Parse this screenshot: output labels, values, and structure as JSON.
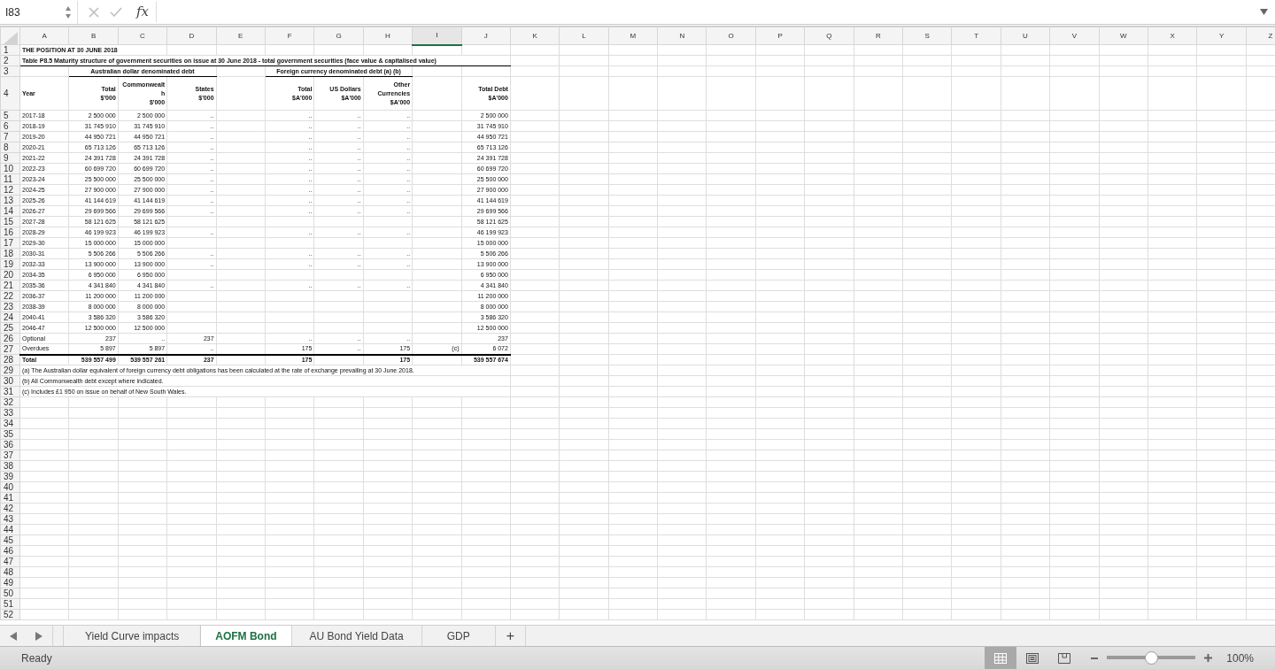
{
  "formula_bar": {
    "name_box": "I83",
    "fx": "fx"
  },
  "columns": [
    {
      "letter": "A",
      "selected": false
    },
    {
      "letter": "B",
      "selected": false
    },
    {
      "letter": "C",
      "selected": false
    },
    {
      "letter": "D",
      "selected": false
    },
    {
      "letter": "E",
      "selected": false
    },
    {
      "letter": "F",
      "selected": false
    },
    {
      "letter": "G",
      "selected": false
    },
    {
      "letter": "H",
      "selected": false
    },
    {
      "letter": "I",
      "selected": true
    },
    {
      "letter": "J",
      "selected": false
    },
    {
      "letter": "K",
      "selected": false
    },
    {
      "letter": "L",
      "selected": false
    },
    {
      "letter": "M",
      "selected": false
    },
    {
      "letter": "N",
      "selected": false
    },
    {
      "letter": "O",
      "selected": false
    },
    {
      "letter": "P",
      "selected": false
    },
    {
      "letter": "Q",
      "selected": false
    },
    {
      "letter": "R",
      "selected": false
    },
    {
      "letter": "S",
      "selected": false
    },
    {
      "letter": "T",
      "selected": false
    },
    {
      "letter": "U",
      "selected": false
    },
    {
      "letter": "V",
      "selected": false
    },
    {
      "letter": "W",
      "selected": false
    },
    {
      "letter": "X",
      "selected": false
    },
    {
      "letter": "Y",
      "selected": false
    },
    {
      "letter": "Z",
      "selected": false
    }
  ],
  "rows": [
    {
      "number": "1",
      "kind": "title",
      "cells": {
        "A": "THE POSITION AT 30 JUNE 2018"
      }
    },
    {
      "number": "2",
      "kind": "subtitle",
      "cells": {
        "A": "Table P8.5 Maturity structure of government securities on issue at 30 June 2018 - total government securities (face value & capitalised value)"
      }
    },
    {
      "number": "3",
      "kind": "group",
      "cells": {
        "B": "Australian dollar denominated debt",
        "F": "Foreign currency denominated debt (a) (b)"
      }
    },
    {
      "number": "4",
      "kind": "header",
      "cells": {
        "A": "Year",
        "B": "Total\n$'000",
        "C": "Commonwealt\nh\n$'000",
        "D": "States\n$'000",
        "F": "Total\n$A'000",
        "G": "US Dollars\n$A'000",
        "H": "Other\nCurrencies\n$A'000",
        "J": "Total Debt\n$A'000"
      }
    },
    {
      "number": "5",
      "kind": "data",
      "cells": {
        "A": "2017-18",
        "B": "2 500 000",
        "C": "2 500 000",
        "D": "..",
        "F": "..",
        "G": "..",
        "H": "..",
        "J": "2 500 000"
      }
    },
    {
      "number": "6",
      "kind": "data",
      "cells": {
        "A": "2018-19",
        "B": "31 745 910",
        "C": "31 745 910",
        "D": "..",
        "F": "..",
        "G": "..",
        "H": "..",
        "J": "31 745 910"
      }
    },
    {
      "number": "7",
      "kind": "data",
      "cells": {
        "A": "2019-20",
        "B": "44 950 721",
        "C": "44 950 721",
        "D": "..",
        "F": "..",
        "G": "..",
        "H": "..",
        "J": "44 950 721"
      }
    },
    {
      "number": "8",
      "kind": "data",
      "cells": {
        "A": "2020-21",
        "B": "65 713 126",
        "C": "65 713 126",
        "D": "..",
        "F": "..",
        "G": "..",
        "H": "..",
        "J": "65 713 126"
      }
    },
    {
      "number": "9",
      "kind": "data",
      "cells": {
        "A": "2021-22",
        "B": "24 391 728",
        "C": "24 391 728",
        "D": "..",
        "F": "..",
        "G": "..",
        "H": "..",
        "J": "24 391 728"
      }
    },
    {
      "number": "10",
      "kind": "data",
      "cells": {
        "A": "2022-23",
        "B": "60 699 720",
        "C": "60 699 720",
        "D": "..",
        "F": "..",
        "G": "..",
        "H": "..",
        "J": "60 699 720"
      }
    },
    {
      "number": "11",
      "kind": "data",
      "cells": {
        "A": "2023-24",
        "B": "25 500 000",
        "C": "25 500 000",
        "D": "..",
        "F": "..",
        "G": "..",
        "H": "..",
        "J": "25 500 000"
      }
    },
    {
      "number": "12",
      "kind": "data",
      "cells": {
        "A": "2024-25",
        "B": "27 900 000",
        "C": "27 900 000",
        "D": "..",
        "F": "..",
        "G": "..",
        "H": "..",
        "J": "27 900 000"
      }
    },
    {
      "number": "13",
      "kind": "data",
      "cells": {
        "A": "2025-26",
        "B": "41 144 619",
        "C": "41 144 619",
        "D": "..",
        "F": "..",
        "G": "..",
        "H": "..",
        "J": "41 144 619"
      }
    },
    {
      "number": "14",
      "kind": "data",
      "cells": {
        "A": "2026-27",
        "B": "29 699 566",
        "C": "29 699 566",
        "D": "..",
        "F": "..",
        "G": "..",
        "H": "..",
        "J": "29 699 566"
      }
    },
    {
      "number": "15",
      "kind": "data",
      "cells": {
        "A": "2027-28",
        "B": "58 121 625",
        "C": "58 121 625",
        "J": "58 121 625"
      }
    },
    {
      "number": "16",
      "kind": "data",
      "cells": {
        "A": "2028-29",
        "B": "46 199 923",
        "C": "46 199 923",
        "D": "..",
        "F": "..",
        "G": "..",
        "H": "..",
        "J": "46 199 923"
      }
    },
    {
      "number": "17",
      "kind": "data",
      "cells": {
        "A": "2029-30",
        "B": "15 000 000",
        "C": "15 000 000",
        "J": "15 000 000"
      }
    },
    {
      "number": "18",
      "kind": "data",
      "cells": {
        "A": "2030-31",
        "B": "5 506 266",
        "C": "5 506 266",
        "D": "..",
        "F": "..",
        "G": "..",
        "H": "..",
        "J": "5 506 266"
      }
    },
    {
      "number": "19",
      "kind": "data",
      "cells": {
        "A": "2032-33",
        "B": "13 900 000",
        "C": "13 900 000",
        "D": "..",
        "F": "..",
        "G": "..",
        "H": "..",
        "J": "13 900 000"
      }
    },
    {
      "number": "20",
      "kind": "data",
      "cells": {
        "A": "2034-35",
        "B": "6 950 000",
        "C": "6 950 000",
        "J": "6 950 000"
      }
    },
    {
      "number": "21",
      "kind": "data",
      "cells": {
        "A": "2035-36",
        "B": "4 341 840",
        "C": "4 341 840",
        "D": "..",
        "F": "..",
        "G": "..",
        "H": "..",
        "J": "4 341 840"
      }
    },
    {
      "number": "22",
      "kind": "data",
      "cells": {
        "A": "2036-37",
        "B": "11 200 000",
        "C": "11 200 000",
        "J": "11 200 000"
      }
    },
    {
      "number": "23",
      "kind": "data",
      "cells": {
        "A": "2038-39",
        "B": "8 000 000",
        "C": "8 000 000",
        "J": "8 000 000"
      }
    },
    {
      "number": "24",
      "kind": "data",
      "cells": {
        "A": "2040-41",
        "B": "3 586 320",
        "C": "3 586 320",
        "J": "3 586 320"
      }
    },
    {
      "number": "25",
      "kind": "data",
      "cells": {
        "A": "2046-47",
        "B": "12 500 000",
        "C": "12 500 000",
        "J": "12 500 000"
      }
    },
    {
      "number": "26",
      "kind": "data",
      "cells": {
        "A": "Optional",
        "B": "237",
        "C": "..",
        "D": "237",
        "F": "..",
        "G": "..",
        "H": "..",
        "J": "237"
      }
    },
    {
      "number": "27",
      "kind": "data",
      "cells": {
        "A": "Overdues",
        "B": "5 897",
        "C": "5 897",
        "D": "..",
        "F": "175",
        "G": "..",
        "H": "175",
        "I": "(c)",
        "J": "6 072"
      }
    },
    {
      "number": "28",
      "kind": "total",
      "cells": {
        "A": "Total",
        "B": "539 557 499",
        "C": "539 557 261",
        "D": "237",
        "F": "175",
        "H": "175",
        "J": "539 557 674"
      }
    },
    {
      "number": "29",
      "kind": "note",
      "cells": {
        "A": "(a) The Australian dollar equivalent of foreign currency debt obligations has been calculated at the rate of exchange prevailing at 30 June 2018."
      }
    },
    {
      "number": "30",
      "kind": "note",
      "cells": {
        "A": "(b) All Commonwealth debt except where indicated."
      }
    },
    {
      "number": "31",
      "kind": "note",
      "cells": {
        "A": "(c) Includes £1 950 on issue on behalf of New South Wales."
      }
    },
    {
      "number": "32",
      "kind": "data"
    },
    {
      "number": "33",
      "kind": "data"
    },
    {
      "number": "34",
      "kind": "data"
    },
    {
      "number": "35",
      "kind": "data"
    },
    {
      "number": "36",
      "kind": "data"
    },
    {
      "number": "37",
      "kind": "data"
    },
    {
      "number": "38",
      "kind": "data"
    },
    {
      "number": "39",
      "kind": "data"
    },
    {
      "number": "40",
      "kind": "data"
    },
    {
      "number": "41",
      "kind": "data"
    },
    {
      "number": "42",
      "kind": "data"
    },
    {
      "number": "43",
      "kind": "data"
    },
    {
      "number": "44",
      "kind": "data"
    },
    {
      "number": "45",
      "kind": "data"
    },
    {
      "number": "46",
      "kind": "data"
    },
    {
      "number": "47",
      "kind": "data"
    },
    {
      "number": "48",
      "kind": "data"
    },
    {
      "number": "49",
      "kind": "data"
    },
    {
      "number": "50",
      "kind": "data"
    },
    {
      "number": "51",
      "kind": "data"
    },
    {
      "number": "52",
      "kind": "data"
    }
  ],
  "sheet_tabs": [
    {
      "label": "Yield Curve impacts",
      "selected": false
    },
    {
      "label": "AOFM Bond",
      "selected": true
    },
    {
      "label": "AU Bond Yield Data",
      "selected": false
    },
    {
      "label": "GDP",
      "selected": false
    }
  ],
  "add_tab": "+",
  "status_bar": {
    "status": "Ready",
    "views": [
      {
        "kind": "normal",
        "selected": true
      },
      {
        "kind": "page-layout",
        "selected": false
      },
      {
        "kind": "page-break",
        "selected": false
      }
    ],
    "zoom": {
      "level": 0.5,
      "reading": "100%"
    }
  }
}
